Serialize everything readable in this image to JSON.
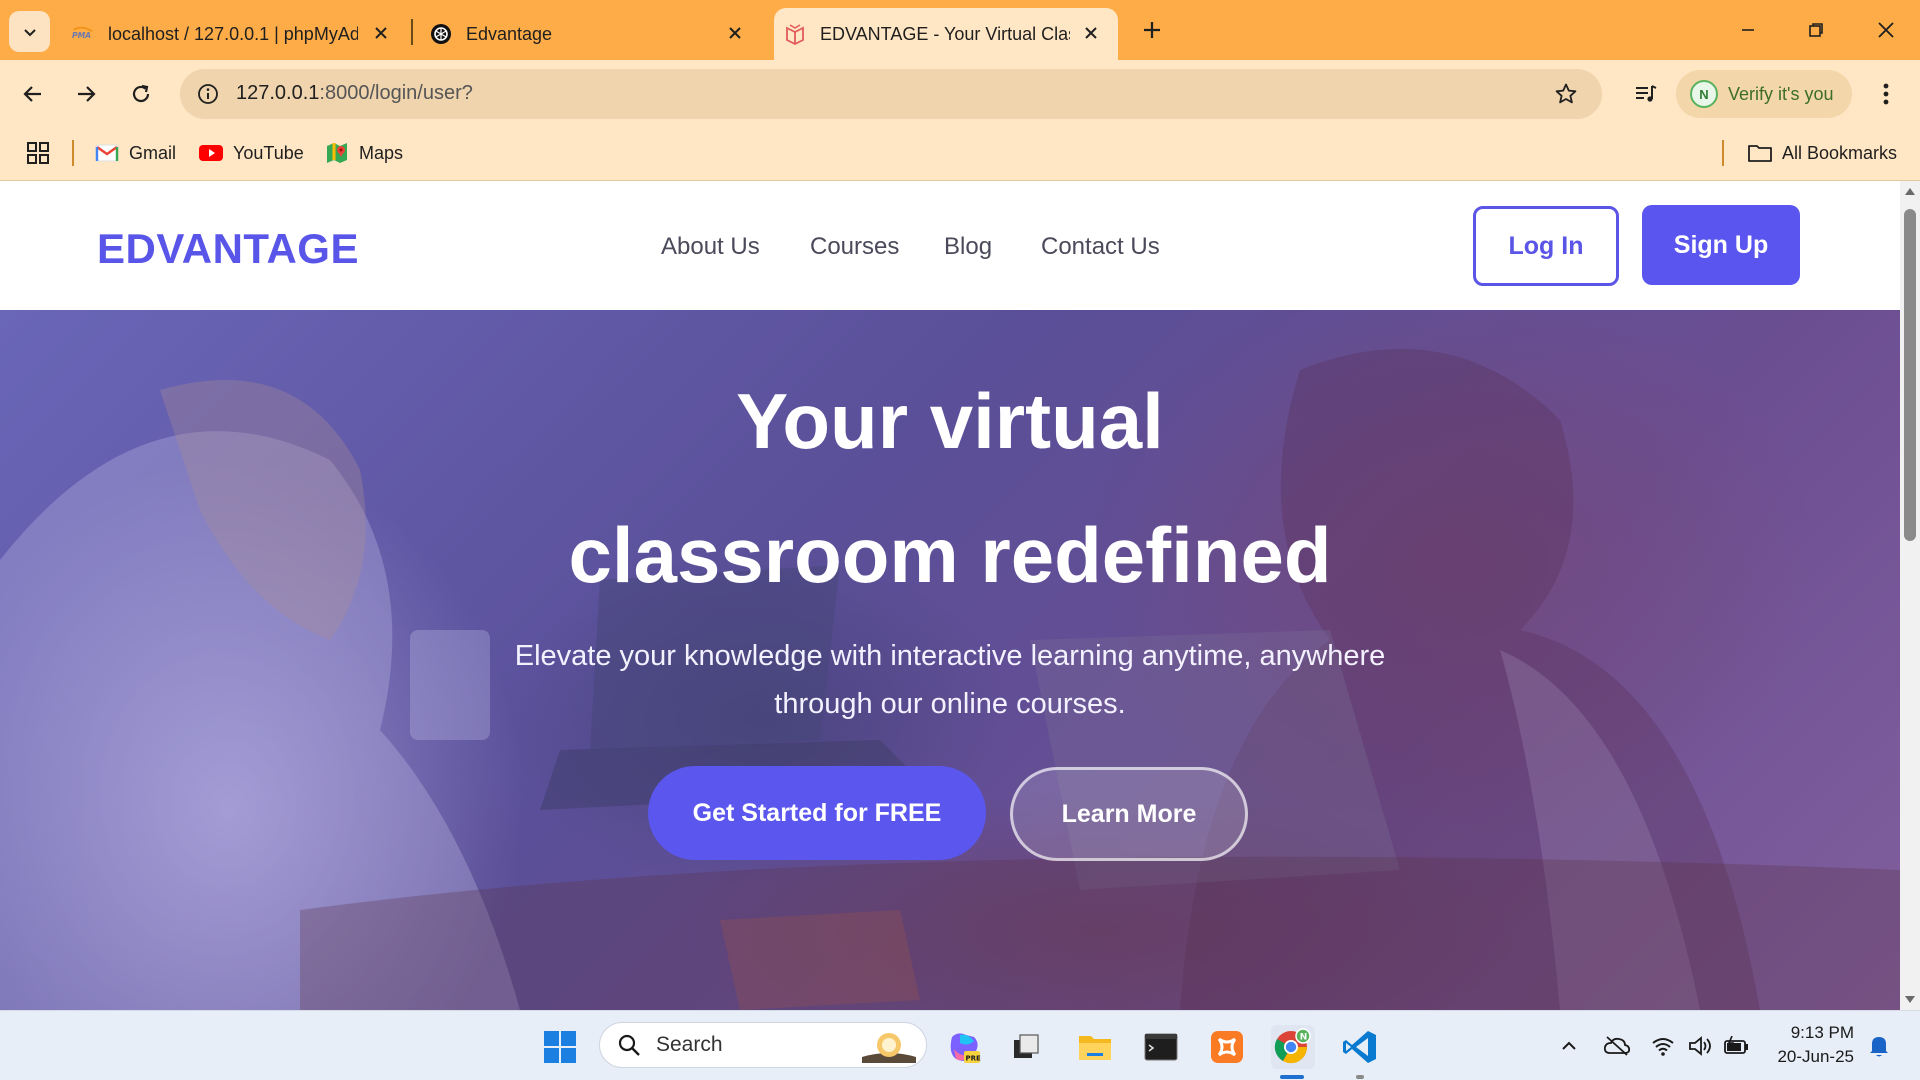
{
  "browser": {
    "tabs": [
      {
        "title": "localhost / 127.0.0.1 | phpMyAd",
        "icon": "phpmyadmin-icon"
      },
      {
        "title": "Edvantage",
        "icon": "openai-icon"
      },
      {
        "title": "EDVANTAGE - Your Virtual Class",
        "icon": "edvantage-icon",
        "active": true
      }
    ],
    "url_host": "127.0.0.1",
    "url_path": ":8000/login/user?",
    "profile_label": "Verify it's you",
    "profile_initial": "N",
    "bookmarks": [
      {
        "label": "Gmail",
        "icon": "gmail-icon"
      },
      {
        "label": "YouTube",
        "icon": "youtube-icon"
      },
      {
        "label": "Maps",
        "icon": "maps-icon"
      }
    ],
    "all_bookmarks": "All Bookmarks"
  },
  "site": {
    "brand": "EDVANTAGE",
    "nav": [
      "About Us",
      "Courses",
      "Blog",
      "Contact Us"
    ],
    "login_label": "Log In",
    "signup_label": "Sign Up"
  },
  "hero": {
    "title_line1": "Your virtual",
    "title_line2": "classroom redefined",
    "subtitle": "Elevate your knowledge with interactive learning anytime, anywhere through our online courses.",
    "cta_primary": "Get Started for FREE",
    "cta_secondary": "Learn More"
  },
  "taskbar": {
    "search_label": "Search",
    "time": "9:13 PM",
    "date": "20-Jun-25"
  },
  "colors": {
    "brand": "#5855e8",
    "tabbar": "#fdac48",
    "toolbar": "#ffe6c4",
    "cta": "#5b57ee"
  }
}
